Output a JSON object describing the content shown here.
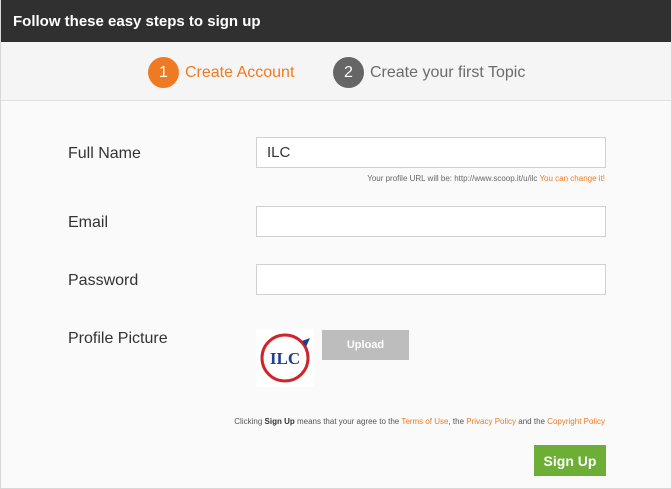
{
  "header": {
    "title": "Follow these easy steps to sign up"
  },
  "steps": [
    {
      "number": "1",
      "label": "Create Account"
    },
    {
      "number": "2",
      "label": "Create your first Topic"
    }
  ],
  "colors": {
    "accent": "#ee7b23",
    "signup": "#6cae36",
    "header_bg": "#303030"
  },
  "form": {
    "full_name": {
      "label": "Full Name",
      "value": "ILC"
    },
    "profile_url": {
      "prefix": "Your profile URL will be: http://www.scoop.it/u/ilc",
      "change_link": "You can change it!"
    },
    "email": {
      "label": "Email",
      "value": ""
    },
    "password": {
      "label": "Password",
      "value": ""
    },
    "profile_picture": {
      "label": "Profile Picture",
      "avatar_text": "ILC",
      "upload_label": "Upload"
    },
    "terms": {
      "part1": "Clicking ",
      "signup_word": "Sign Up",
      "part2": " means that your agree to the ",
      "terms_link": "Terms of Use",
      "part3": ", the ",
      "privacy_link": "Privacy Policy",
      "part4": " and the ",
      "copyright_link": "Copyright Policy"
    },
    "signup_label": "Sign Up"
  }
}
